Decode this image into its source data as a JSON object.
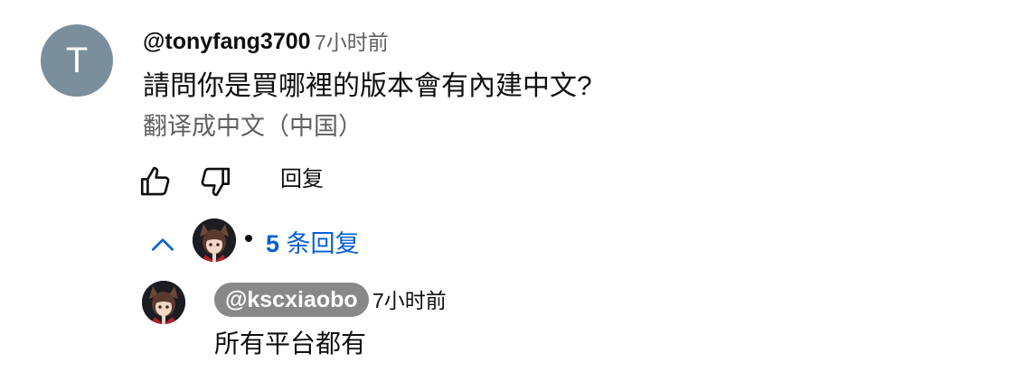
{
  "comment": {
    "avatar_letter": "T",
    "avatar_color": "#7a8e9b",
    "author": "@tonyfang3700",
    "time": "7小时前",
    "text": "請問你是買哪裡的版本會有內建中文?",
    "translate_label": "翻译成中文（中国）",
    "like_icon": "thumbs-up-icon",
    "dislike_icon": "thumbs-down-icon",
    "reply_label": "回复"
  },
  "replies_toggle": {
    "icon": "chevron-up-icon",
    "count": "5",
    "label": "条回复",
    "link_color": "#065fd4"
  },
  "reply": {
    "author": "@kscxiaobo",
    "author_badge_color": "#888888",
    "time": "7小时前",
    "text": "所有平台都有"
  }
}
